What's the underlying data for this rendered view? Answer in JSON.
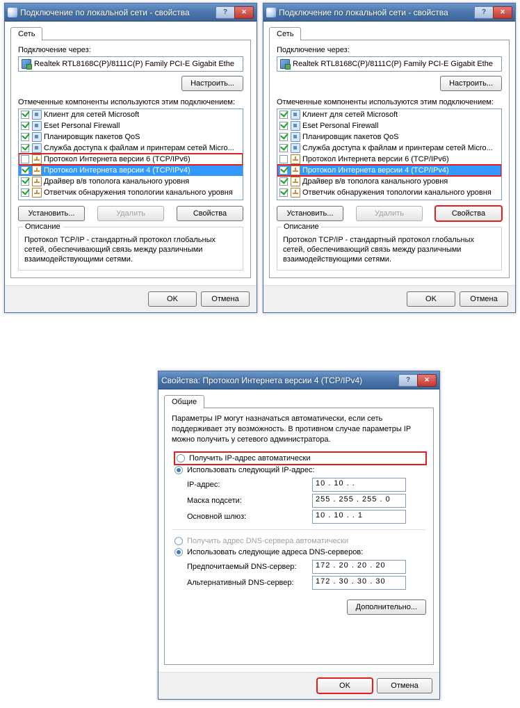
{
  "win1": {
    "title": "Подключение по локальной сети - свойства",
    "tab": "Сеть",
    "connect_via": "Подключение через:",
    "adapter": "Realtek RTL8168C(P)/8111C(P) Family PCI-E Gigabit Ethe",
    "configure": "Настроить...",
    "components_label": "Отмеченные компоненты используются этим подключением:",
    "items": [
      {
        "checked": true,
        "icon": "svc",
        "label": "Клиент для сетей Microsoft"
      },
      {
        "checked": true,
        "icon": "svc",
        "label": "Eset Personal Firewall"
      },
      {
        "checked": true,
        "icon": "svc",
        "label": "Планировщик пакетов QoS"
      },
      {
        "checked": true,
        "icon": "svc",
        "label": "Служба доступа к файлам и принтерам сетей Micro..."
      },
      {
        "checked": false,
        "icon": "proto",
        "label": "Протокол Интернета версии 6 (TCP/IPv6)"
      },
      {
        "checked": true,
        "icon": "proto",
        "label": "Протокол Интернета версии 4 (TCP/IPv4)"
      },
      {
        "checked": true,
        "icon": "proto",
        "label": "Драйвер в/в тополога канального уровня"
      },
      {
        "checked": true,
        "icon": "proto",
        "label": "Ответчик обнаружения топологии канального уровня"
      }
    ],
    "install": "Установить...",
    "uninstall": "Удалить",
    "properties": "Свойства",
    "desc_title": "Описание",
    "desc_text": "Протокол TCP/IP - стандартный протокол глобальных сетей, обеспечивающий связь между различными взаимодействующими сетями.",
    "ok": "OK",
    "cancel": "Отмена"
  },
  "win3": {
    "title": "Свойства: Протокол Интернета версии 4 (TCP/IPv4)",
    "tab": "Общие",
    "info": "Параметры IP могут назначаться автоматически, если сеть поддерживает эту возможность. В противном случае параметры IP можно получить у сетевого администратора.",
    "radio_auto_ip": "Получить IP-адрес автоматически",
    "radio_manual_ip": "Использовать следующий IP-адрес:",
    "ip_label": "IP-адрес:",
    "ip_value": "10 . 10 .           .",
    "mask_label": "Маска подсети:",
    "mask_value": "255 . 255 . 255 .   0",
    "gw_label": "Основной шлюз:",
    "gw_value": "10 . 10 .           .   1",
    "radio_auto_dns": "Получить адрес DNS-сервера автоматически",
    "radio_manual_dns": "Использовать следующие адреса DNS-серверов:",
    "dns1_label": "Предпочитаемый DNS-сервер:",
    "dns1_value": "172 . 20 . 20 . 20",
    "dns2_label": "Альтернативный DNS-сервер:",
    "dns2_value": "172 . 30 . 30 . 30",
    "advanced": "Дополнительно...",
    "ok": "OK",
    "cancel": "Отмена"
  }
}
